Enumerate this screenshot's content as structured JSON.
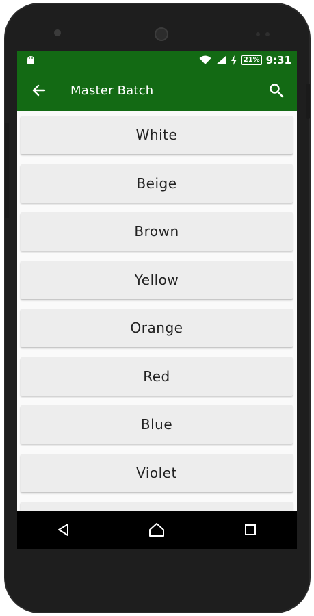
{
  "status_bar": {
    "battery": "21%",
    "time": "9:31",
    "icons": [
      "android-icon",
      "wifi-icon",
      "signal-icon",
      "charging-icon",
      "battery-icon"
    ]
  },
  "app_bar": {
    "title": "Master Batch",
    "back_icon": "arrow-back-icon",
    "search_icon": "search-icon",
    "color": "#136a14"
  },
  "list": {
    "items": [
      "White",
      "Beige",
      "Brown",
      "Yellow",
      "Orange",
      "Red",
      "Blue",
      "Violet"
    ]
  },
  "nav_bar": {
    "icons": [
      "back-triangle-icon",
      "home-icon",
      "recents-icon"
    ]
  }
}
